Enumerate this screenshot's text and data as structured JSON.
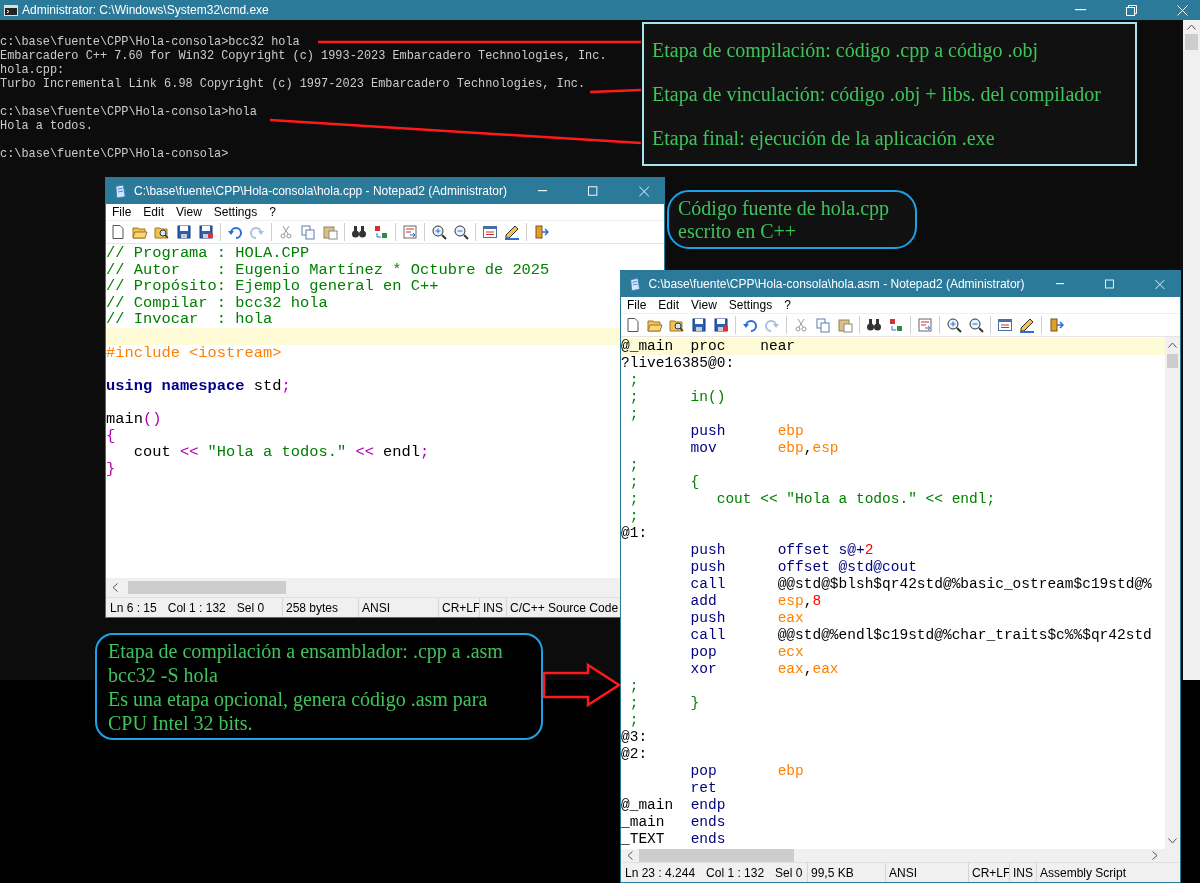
{
  "console": {
    "title": "Administrator: C:\\Windows\\System32\\cmd.exe",
    "blocks": [
      [
        "c:\\base\\fuente\\CPP\\Hola-consola>bcc32 hola",
        "Embarcadero C++ 7.60 for Win32 Copyright (c) 1993-2023 Embarcadero Technologies, Inc.",
        "hola.cpp:",
        "Turbo Incremental Link 6.98 Copyright (c) 1997-2023 Embarcadero Technologies, Inc."
      ],
      [
        "c:\\base\\fuente\\CPP\\Hola-consola>hola",
        "Hola a todos."
      ],
      [
        "c:\\base\\fuente\\CPP\\Hola-consola>"
      ]
    ]
  },
  "notepad_cpp": {
    "title": "C:\\base\\fuente\\CPP\\Hola-consola\\hola.cpp - Notepad2 (Administrator)",
    "menu": [
      "File",
      "Edit",
      "View",
      "Settings",
      "?"
    ],
    "lines": [
      {
        "current": false,
        "tokens": [
          {
            "text": "// Programa : HOLA.CPP",
            "kind": "comment"
          }
        ]
      },
      {
        "current": false,
        "tokens": [
          {
            "text": "// Autor    : Eugenio Martínez * Octubre de 2025",
            "kind": "comment"
          }
        ]
      },
      {
        "current": false,
        "tokens": [
          {
            "text": "// Propósito: Ejemplo general en C++",
            "kind": "comment"
          }
        ]
      },
      {
        "current": false,
        "tokens": [
          {
            "text": "// Compilar : bcc32 hola",
            "kind": "comment"
          }
        ]
      },
      {
        "current": false,
        "tokens": [
          {
            "text": "// Invocar  : hola",
            "kind": "comment"
          }
        ]
      },
      {
        "current": true
      },
      {
        "current": false,
        "tokens": [
          {
            "text": "#include <iostream>",
            "kind": "preproc"
          }
        ]
      },
      {
        "current": false
      },
      {
        "current": false,
        "tokens": [
          {
            "text": "using namespace",
            "kind": "keyword"
          },
          {
            "text": " std",
            "kind": "plain"
          },
          {
            "text": ";",
            "kind": "op"
          }
        ]
      },
      {
        "current": false
      },
      {
        "current": false,
        "tokens": [
          {
            "text": "main",
            "kind": "plain"
          },
          {
            "text": "()",
            "kind": "op"
          }
        ]
      },
      {
        "current": false,
        "tokens": [
          {
            "text": "{",
            "kind": "op"
          }
        ]
      },
      {
        "current": false,
        "tokens": [
          {
            "text": "   cout ",
            "kind": "plain"
          },
          {
            "text": "<<",
            "kind": "op"
          },
          {
            "text": " \"Hola a todos.\" ",
            "kind": "string"
          },
          {
            "text": "<<",
            "kind": "op"
          },
          {
            "text": " endl",
            "kind": "plain"
          },
          {
            "text": ";",
            "kind": "op"
          }
        ]
      },
      {
        "current": false,
        "tokens": [
          {
            "text": "}",
            "kind": "op"
          }
        ]
      }
    ],
    "status": {
      "position": [
        "Ln 6 : 15",
        "Col 1 : 132",
        "Sel 0"
      ],
      "size": "258 bytes",
      "encoding": "ANSI",
      "eol": "CR+LF",
      "mode": "INS",
      "lexer": "C/C++ Source Code"
    }
  },
  "notepad_asm": {
    "title": "C:\\base\\fuente\\CPP\\Hola-consola\\hola.asm - Notepad2 (Administrator)",
    "menu": [
      "File",
      "Edit",
      "View",
      "Settings",
      "?"
    ],
    "lines": [
      {
        "current": true,
        "tokens": [
          {
            "text": "@_main  proc    near",
            "kind": "plain"
          }
        ]
      },
      {
        "current": false,
        "tokens": [
          {
            "text": "?live16385@0:",
            "kind": "plain"
          }
        ]
      },
      {
        "current": false,
        "tokens": [
          {
            "text": " ;",
            "kind": "comment"
          }
        ]
      },
      {
        "current": false,
        "tokens": [
          {
            "text": " ;      in()",
            "kind": "comment"
          }
        ]
      },
      {
        "current": false,
        "tokens": [
          {
            "text": " ;",
            "kind": "comment"
          }
        ]
      },
      {
        "current": false,
        "tokens": [
          {
            "text": "        push      ",
            "kind": "instr"
          },
          {
            "text": "ebp",
            "kind": "reg"
          }
        ]
      },
      {
        "current": false,
        "tokens": [
          {
            "text": "        mov       ",
            "kind": "instr"
          },
          {
            "text": "ebp",
            "kind": "reg"
          },
          {
            "text": ",",
            "kind": "plain"
          },
          {
            "text": "esp",
            "kind": "reg"
          }
        ]
      },
      {
        "current": false,
        "tokens": [
          {
            "text": " ;",
            "kind": "comment"
          }
        ]
      },
      {
        "current": false,
        "tokens": [
          {
            "text": " ;      {",
            "kind": "comment"
          }
        ]
      },
      {
        "current": false,
        "tokens": [
          {
            "text": " ;         cout << \"Hola a todos.\" << endl;",
            "kind": "comment"
          }
        ]
      },
      {
        "current": false,
        "tokens": [
          {
            "text": " ;",
            "kind": "comment"
          }
        ]
      },
      {
        "current": false,
        "tokens": [
          {
            "text": "@1:",
            "kind": "plain"
          }
        ]
      },
      {
        "current": false,
        "tokens": [
          {
            "text": "        push      offset s@+",
            "kind": "instr"
          },
          {
            "text": "2",
            "kind": "num"
          }
        ]
      },
      {
        "current": false,
        "tokens": [
          {
            "text": "        push      offset @std@cout",
            "kind": "instr"
          }
        ]
      },
      {
        "current": false,
        "tokens": [
          {
            "text": "        call      ",
            "kind": "instr"
          },
          {
            "text": "@@std@$blsh$qr42std@%basic_ostream$c19std@%",
            "kind": "plain"
          }
        ]
      },
      {
        "current": false,
        "tokens": [
          {
            "text": "        add       ",
            "kind": "instr"
          },
          {
            "text": "esp",
            "kind": "reg"
          },
          {
            "text": ",",
            "kind": "plain"
          },
          {
            "text": "8",
            "kind": "num"
          }
        ]
      },
      {
        "current": false,
        "tokens": [
          {
            "text": "        push      ",
            "kind": "instr"
          },
          {
            "text": "eax",
            "kind": "reg"
          }
        ]
      },
      {
        "current": false,
        "tokens": [
          {
            "text": "        call      ",
            "kind": "instr"
          },
          {
            "text": "@@std@%endl$c19std@%char_traits$c%%$qr42std",
            "kind": "plain"
          }
        ]
      },
      {
        "current": false,
        "tokens": [
          {
            "text": "        pop       ",
            "kind": "instr"
          },
          {
            "text": "ecx",
            "kind": "reg"
          }
        ]
      },
      {
        "current": false,
        "tokens": [
          {
            "text": "        xor       ",
            "kind": "instr"
          },
          {
            "text": "eax",
            "kind": "reg"
          },
          {
            "text": ",",
            "kind": "plain"
          },
          {
            "text": "eax",
            "kind": "reg"
          }
        ]
      },
      {
        "current": false,
        "tokens": [
          {
            "text": " ;",
            "kind": "comment"
          }
        ]
      },
      {
        "current": false,
        "tokens": [
          {
            "text": " ;      }",
            "kind": "comment"
          }
        ]
      },
      {
        "current": false,
        "tokens": [
          {
            "text": " ;",
            "kind": "comment"
          }
        ]
      },
      {
        "current": false,
        "tokens": [
          {
            "text": "@3:",
            "kind": "plain"
          }
        ]
      },
      {
        "current": false,
        "tokens": [
          {
            "text": "@2:",
            "kind": "plain"
          }
        ]
      },
      {
        "current": false,
        "tokens": [
          {
            "text": "        pop       ",
            "kind": "instr"
          },
          {
            "text": "ebp",
            "kind": "reg"
          }
        ]
      },
      {
        "current": false,
        "tokens": [
          {
            "text": "        ret",
            "kind": "instr"
          }
        ]
      },
      {
        "current": false,
        "tokens": [
          {
            "text": "@_main  ",
            "kind": "plain"
          },
          {
            "text": "endp",
            "kind": "instr"
          }
        ]
      },
      {
        "current": false,
        "tokens": [
          {
            "text": "_main   ",
            "kind": "plain"
          },
          {
            "text": "ends",
            "kind": "instr"
          }
        ]
      },
      {
        "current": false,
        "tokens": [
          {
            "text": "_TEXT   ",
            "kind": "plain"
          },
          {
            "text": "ends",
            "kind": "instr"
          }
        ]
      }
    ],
    "status": {
      "position": [
        "Ln 23 : 4.244",
        "Col 1 : 132",
        "Sel 0"
      ],
      "size": "99,5 KB",
      "encoding": "ANSI",
      "eol": "CR+LF",
      "mode": "INS",
      "lexer": "Assembly Script"
    }
  },
  "stages_box": {
    "lines": [
      "Etapa de compilación: código .cpp a código .obj",
      "Etapa de vinculación: código .obj + libs. del compilador",
      "Etapa final: ejecución de la aplicación .exe"
    ]
  },
  "source_note": {
    "lines": [
      "Código fuente de hola.cpp",
      "escrito en C++"
    ]
  },
  "asm_note": {
    "lines": [
      "Etapa de compilación a ensamblador: .cpp a .asm",
      "bcc32 -S hola",
      "Es una etapa opcional, genera código .asm para",
      "CPU Intel 32 bits."
    ]
  }
}
